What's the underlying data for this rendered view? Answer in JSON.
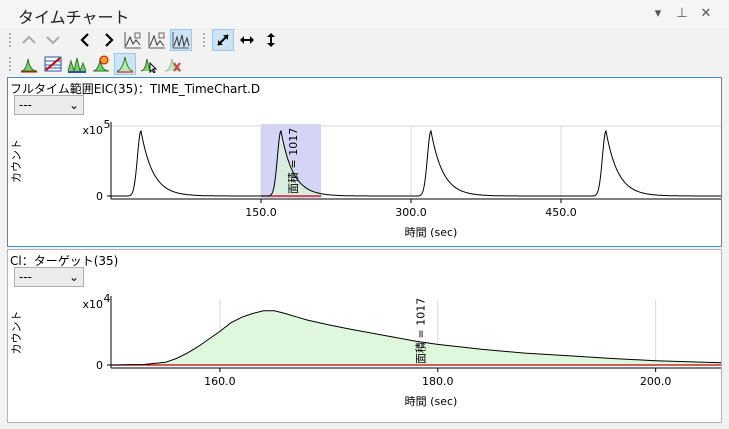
{
  "window": {
    "title": "タイムチャート",
    "controls": [
      {
        "name": "dropdown-arrow-icon",
        "glyph": "▾"
      },
      {
        "name": "pin-icon",
        "glyph": "⊥"
      },
      {
        "name": "close-icon",
        "glyph": "✕"
      }
    ]
  },
  "toolbar1": {
    "buttons": [
      {
        "name": "prev-up-icon",
        "active": false
      },
      {
        "name": "next-down-icon",
        "active": false
      },
      {
        "name": "back-icon",
        "active": false
      },
      {
        "name": "forward-icon",
        "active": false
      },
      {
        "name": "chart-overlay-1-icon",
        "active": false
      },
      {
        "name": "chart-overlay-2-icon",
        "active": false
      },
      {
        "name": "chart-overlay-3-icon",
        "active": true
      },
      {
        "name": "autoscale-xy-icon",
        "active": true
      },
      {
        "name": "autoscale-x-icon",
        "active": false
      },
      {
        "name": "autoscale-y-icon",
        "active": false
      }
    ]
  },
  "toolbar2": {
    "buttons": [
      {
        "name": "integrate-icon",
        "active": false
      },
      {
        "name": "peak-table-icon",
        "active": false
      },
      {
        "name": "peaks-icon",
        "active": false
      },
      {
        "name": "peak-marker-icon",
        "active": false
      },
      {
        "name": "peak-select-icon",
        "active": true
      },
      {
        "name": "peak-cursor-icon",
        "active": false
      },
      {
        "name": "peak-delete-icon",
        "active": false
      }
    ]
  },
  "pane1": {
    "title": "フルタイム範囲EIC(35)：TIME_TimeChart.D",
    "dropdown_value": "---",
    "chart_data": {
      "type": "line",
      "xlabel": "時間 (sec)",
      "ylabel": "カウント",
      "y_multiplier": "x10",
      "y_exponent": "5",
      "x_ticks": [
        "150.0",
        "300.0",
        "450.0"
      ],
      "x_tick_values": [
        150,
        300,
        450
      ],
      "y_ticks": [
        "0"
      ],
      "xlim": [
        0,
        610
      ],
      "ylim": [
        0,
        1.4
      ],
      "peaks_at": [
        30,
        170,
        320,
        495
      ],
      "peak_height": 1.3,
      "highlight_range": [
        150,
        210
      ],
      "annotation": "面積 = 1017",
      "line_color": "#000000",
      "baseline_color": "#c00000",
      "highlight_color": "#c9c9f5"
    }
  },
  "pane2": {
    "title": "Cl：ターゲット(35)",
    "dropdown_value": "---",
    "chart_data": {
      "type": "area",
      "xlabel": "時間 (sec)",
      "ylabel": "カウント",
      "y_multiplier": "x10",
      "y_exponent": "4",
      "x_ticks": [
        "160.0",
        "180.0",
        "200.0"
      ],
      "x_tick_values": [
        160,
        180,
        200
      ],
      "y_ticks": [
        "0"
      ],
      "xlim": [
        150,
        206
      ],
      "ylim": [
        0,
        1.2
      ],
      "x": [
        150,
        153,
        155,
        156,
        157,
        158,
        160,
        161,
        162,
        163,
        164,
        165,
        166,
        167,
        168,
        170,
        172,
        175,
        178,
        180,
        184,
        188,
        192,
        196,
        200,
        206
      ],
      "y": [
        0.0,
        0.01,
        0.05,
        0.12,
        0.22,
        0.34,
        0.62,
        0.78,
        0.88,
        0.95,
        1.0,
        1.0,
        0.95,
        0.89,
        0.83,
        0.74,
        0.66,
        0.55,
        0.44,
        0.38,
        0.29,
        0.22,
        0.17,
        0.12,
        0.08,
        0.04
      ],
      "annotation": "面積 = 1017",
      "line_color": "#000000",
      "fill_color": "#dff7dc",
      "baseline_color": "#c00000"
    }
  }
}
